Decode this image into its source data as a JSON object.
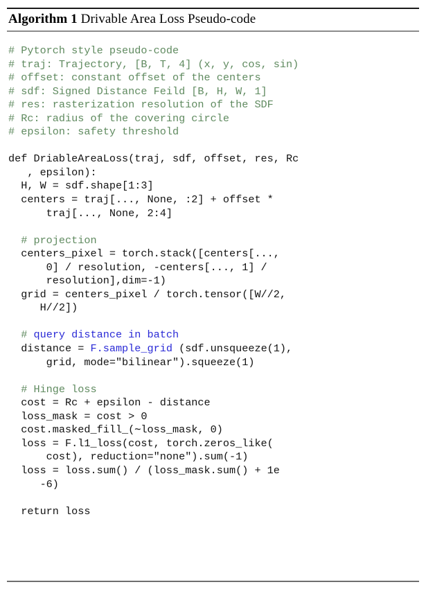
{
  "caption": {
    "label": "Algorithm 1",
    "title": "Drivable Area Loss Pseudo-code"
  },
  "colors": {
    "comment_green": "#5f8a5f",
    "comment_blue": "#2a2ad6",
    "function_blue": "#2a2ad6",
    "code_black": "#111111",
    "rule_dark": "#1a1a1a",
    "rule_gray": "#8c8c8c"
  },
  "code": {
    "language": "python",
    "lines": [
      {
        "id": "l01",
        "text": "# Pytorch style pseudo-code",
        "kind": "comment"
      },
      {
        "id": "l02",
        "text": "# traj: Trajectory, [B, T, 4] (x, y, cos, sin)",
        "kind": "comment"
      },
      {
        "id": "l03",
        "text": "# offset: constant offset of the centers",
        "kind": "comment"
      },
      {
        "id": "l04",
        "text": "# sdf: Signed Distance Feild [B, H, W, 1]",
        "kind": "comment"
      },
      {
        "id": "l05",
        "text": "# res: rasterization resolution of the SDF",
        "kind": "comment"
      },
      {
        "id": "l06",
        "text": "# Rc: radius of the covering circle",
        "kind": "comment"
      },
      {
        "id": "l07",
        "text": "# epsilon: safety threshold",
        "kind": "comment"
      },
      {
        "id": "l08",
        "text": "",
        "kind": "blank"
      },
      {
        "id": "l09",
        "text": "def DriableAreaLoss(traj, sdf, offset, res, Rc",
        "kind": "code"
      },
      {
        "id": "l10",
        "text": "   , epsilon):",
        "kind": "code"
      },
      {
        "id": "l11",
        "text": "  H, W = sdf.shape[1:3]",
        "kind": "code"
      },
      {
        "id": "l12",
        "text": "  centers = traj[..., None, :2] + offset *",
        "kind": "code"
      },
      {
        "id": "l13",
        "text": "      traj[..., None, 2:4]",
        "kind": "code"
      },
      {
        "id": "l14",
        "text": "",
        "kind": "blank"
      },
      {
        "id": "l15",
        "text": "  # projection",
        "kind": "comment"
      },
      {
        "id": "l16",
        "text": "  centers_pixel = torch.stack([centers[...,",
        "kind": "code"
      },
      {
        "id": "l17",
        "text": "      0] / resolution, -centers[..., 1] /",
        "kind": "code"
      },
      {
        "id": "l18",
        "text": "      resolution],dim=-1)",
        "kind": "code"
      },
      {
        "id": "l19",
        "text": "  grid = centers_pixel / torch.tensor([W//2,",
        "kind": "code"
      },
      {
        "id": "l20",
        "text": "     H//2])",
        "kind": "code"
      },
      {
        "id": "l21",
        "text": "",
        "kind": "blank"
      },
      {
        "id": "l22",
        "text": "  # query distance in batch",
        "kind": "comment-blue"
      },
      {
        "id": "l23",
        "text": "  distance = F.sample_grid (sdf.unsqueeze(1),",
        "kind": "code-fn",
        "fn": "F.sample_grid"
      },
      {
        "id": "l24",
        "text": "      grid, mode=\"bilinear\").squeeze(1)",
        "kind": "code"
      },
      {
        "id": "l25",
        "text": "",
        "kind": "blank"
      },
      {
        "id": "l26",
        "text": "  # Hinge loss",
        "kind": "comment"
      },
      {
        "id": "l27",
        "text": "  cost = Rc + epsilon - distance",
        "kind": "code"
      },
      {
        "id": "l28",
        "text": "  loss_mask = cost > 0",
        "kind": "code"
      },
      {
        "id": "l29",
        "text": "  cost.masked_fill_(∼loss_mask, 0)",
        "kind": "code"
      },
      {
        "id": "l30",
        "text": "  loss = F.l1_loss(cost, torch.zeros_like(",
        "kind": "code"
      },
      {
        "id": "l31",
        "text": "      cost), reduction=\"none\").sum(-1)",
        "kind": "code"
      },
      {
        "id": "l32",
        "text": "  loss = loss.sum() / (loss_mask.sum() + 1e",
        "kind": "code"
      },
      {
        "id": "l33",
        "text": "     -6)",
        "kind": "code"
      },
      {
        "id": "l34",
        "text": "",
        "kind": "blank"
      },
      {
        "id": "l35",
        "text": "  return loss",
        "kind": "code"
      }
    ]
  }
}
